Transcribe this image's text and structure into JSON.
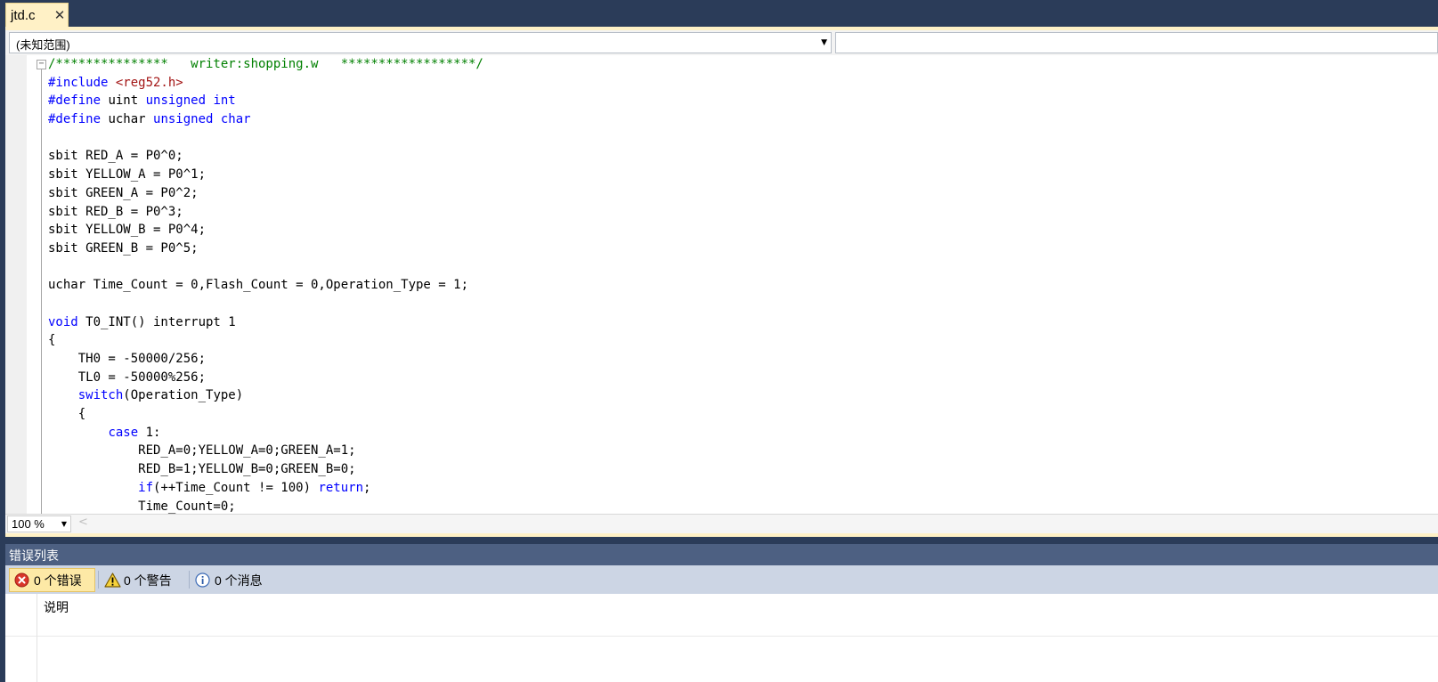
{
  "tab": {
    "label": "jtd.c",
    "close_glyph": "✕"
  },
  "navigation": {
    "scope": "(未知范围)",
    "member": ""
  },
  "code_lines": [
    [
      {
        "t": "/***************   writer:shopping.w   ******************/",
        "c": "comment"
      }
    ],
    [
      {
        "t": "#include ",
        "c": "keyword"
      },
      {
        "t": "<reg52.h>",
        "c": "string"
      }
    ],
    [
      {
        "t": "#define ",
        "c": "keyword"
      },
      {
        "t": "uint ",
        "c": "plain"
      },
      {
        "t": "unsigned int",
        "c": "keyword"
      }
    ],
    [
      {
        "t": "#define ",
        "c": "keyword"
      },
      {
        "t": "uchar ",
        "c": "plain"
      },
      {
        "t": "unsigned char",
        "c": "keyword"
      }
    ],
    [],
    [
      {
        "t": "sbit RED_A = P0^0;",
        "c": "plain"
      }
    ],
    [
      {
        "t": "sbit YELLOW_A = P0^1;",
        "c": "plain"
      }
    ],
    [
      {
        "t": "sbit GREEN_A = P0^2;",
        "c": "plain"
      }
    ],
    [
      {
        "t": "sbit RED_B = P0^3;",
        "c": "plain"
      }
    ],
    [
      {
        "t": "sbit YELLOW_B = P0^4;",
        "c": "plain"
      }
    ],
    [
      {
        "t": "sbit GREEN_B = P0^5;",
        "c": "plain"
      }
    ],
    [],
    [
      {
        "t": "uchar Time_Count = 0,Flash_Count = 0,Operation_Type = 1;",
        "c": "plain"
      }
    ],
    [],
    [
      {
        "t": "void",
        "c": "keyword"
      },
      {
        "t": " T0_INT() interrupt 1",
        "c": "plain"
      }
    ],
    [
      {
        "t": "{",
        "c": "plain"
      }
    ],
    [
      {
        "t": "    TH0 = -50000/256;",
        "c": "plain"
      }
    ],
    [
      {
        "t": "    TL0 = -50000%256;",
        "c": "plain"
      }
    ],
    [
      {
        "t": "    ",
        "c": "plain"
      },
      {
        "t": "switch",
        "c": "keyword"
      },
      {
        "t": "(Operation_Type)",
        "c": "plain"
      }
    ],
    [
      {
        "t": "    {",
        "c": "plain"
      }
    ],
    [
      {
        "t": "        ",
        "c": "plain"
      },
      {
        "t": "case",
        "c": "keyword"
      },
      {
        "t": " 1:",
        "c": "plain"
      }
    ],
    [
      {
        "t": "            RED_A=0;YELLOW_A=0;GREEN_A=1;",
        "c": "plain"
      }
    ],
    [
      {
        "t": "            RED_B=1;YELLOW_B=0;GREEN_B=0;",
        "c": "plain"
      }
    ],
    [
      {
        "t": "            ",
        "c": "plain"
      },
      {
        "t": "if",
        "c": "keyword"
      },
      {
        "t": "(++Time_Count != 100) ",
        "c": "plain"
      },
      {
        "t": "return",
        "c": "keyword"
      },
      {
        "t": ";",
        "c": "plain"
      }
    ],
    [
      {
        "t": "            Time_Count=0;",
        "c": "plain"
      }
    ]
  ],
  "editor": {
    "fold_glyph": "−"
  },
  "statusbar": {
    "zoom": "100 %",
    "scroll_left_glyph": "<"
  },
  "errors_panel": {
    "title": "错误列表",
    "filters": {
      "errors": "0 个错误",
      "warnings": "0 个警告",
      "messages": "0 个消息"
    },
    "columns": {
      "description": "说明"
    }
  },
  "colors": {
    "keyword": "#0000ff",
    "comment": "#008000",
    "string": "#a31515",
    "chrome": "#2b3c59",
    "accent": "#fff1c6"
  },
  "icons": [
    "close-icon",
    "dropdown-arrow-icon",
    "fold-toggle-icon",
    "error-icon",
    "warning-icon",
    "info-icon"
  ]
}
